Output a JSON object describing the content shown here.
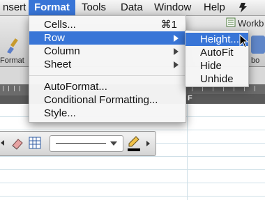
{
  "menubar": {
    "items": [
      "nsert",
      "Format",
      "Tools",
      "Data",
      "Window",
      "Help"
    ],
    "script_icon": "script-menu-icon"
  },
  "toolbar": {
    "format_label": "Format",
    "workbook_label": "Workb",
    "toolbox_label": "bo"
  },
  "ruler": {
    "column_letter": "F"
  },
  "format_menu": {
    "items": [
      {
        "label": "Cells...",
        "shortcut": "⌘1"
      },
      {
        "label": "Row",
        "submenu": true
      },
      {
        "label": "Column",
        "submenu": true
      },
      {
        "label": "Sheet",
        "submenu": true
      },
      {
        "label": "AutoFormat..."
      },
      {
        "label": "Conditional Formatting..."
      },
      {
        "label": "Style..."
      }
    ]
  },
  "row_submenu": {
    "items": [
      "Height...",
      "AutoFit",
      "Hide",
      "Unhide"
    ]
  },
  "colors": {
    "accent": "#3875d7",
    "menu_bg": "#f6f6f6"
  }
}
